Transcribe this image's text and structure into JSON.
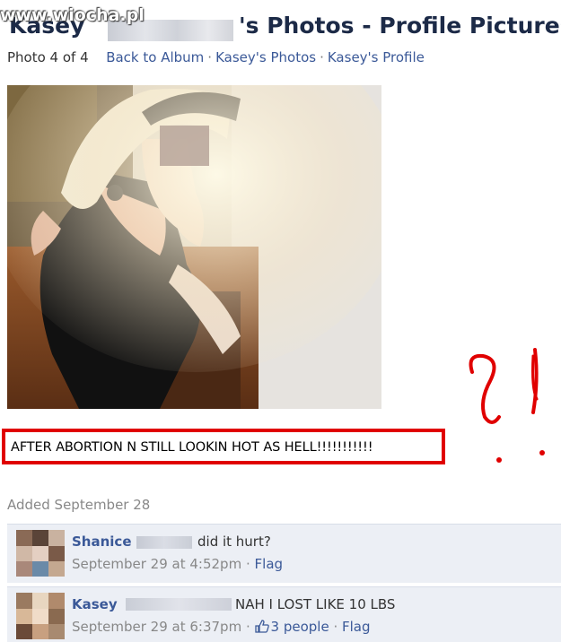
{
  "watermark": "www.wiocha.pl",
  "header": {
    "title_prefix": "Kasey",
    "title_suffix": "'s Photos - Profile Pictures"
  },
  "subnav": {
    "photo_count": "Photo 4 of 4",
    "back_link": "Back to Album",
    "photos_link": "Kasey's Photos",
    "profile_link": "Kasey's Profile",
    "separator": "·"
  },
  "caption": "AFTER ABORTION N STILL LOOKIN HOT AS HELL!!!!!!!!!!!",
  "annotation": "?!",
  "added": "Added September 28",
  "comments": [
    {
      "author": "Shanice",
      "text": "did it hurt?",
      "timestamp": "September 29 at 4:52pm",
      "flag": "Flag"
    },
    {
      "author": "Kasey",
      "text": "NAH I LOST LIKE 10 LBS",
      "timestamp": "September 29 at 6:37pm",
      "likes": "3 people",
      "flag": "Flag"
    }
  ],
  "colors": {
    "link": "#3b5998",
    "title": "#1c2a47",
    "highlight_red": "#e00000",
    "comment_bg": "#eceff5"
  }
}
